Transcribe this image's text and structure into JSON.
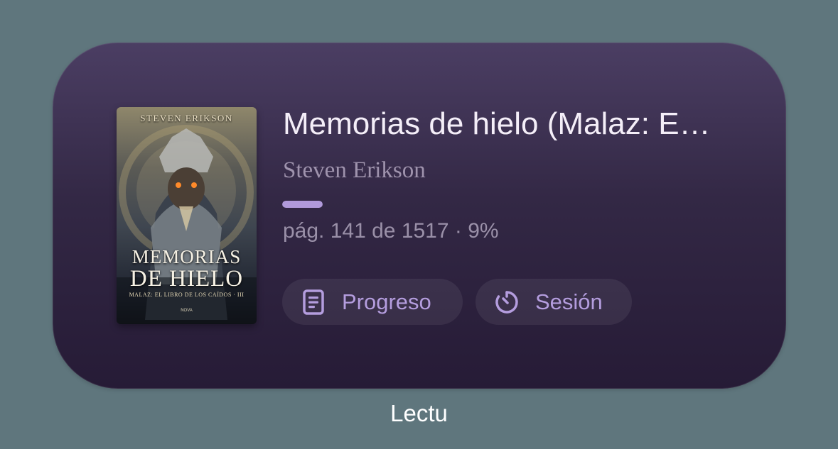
{
  "widget": {
    "book": {
      "title": "Memorias de hielo (Malaz: E…",
      "author": "Steven Erikson",
      "pages_text": "pág. 141 de 1517 · 9%",
      "progress_fraction": 0.09
    },
    "cover": {
      "author_text": "STEVEN ERIKSON",
      "title_line1": "MEMORIAS",
      "title_line2": "DE HIELO",
      "series_text": "MALAZ: EL LIBRO DE LOS CAÍDOS · III",
      "publisher_text": "NOVA"
    },
    "buttons": {
      "progress_label": "Progreso",
      "progress_icon": "document-icon",
      "session_label": "Sesión",
      "session_icon": "timer-icon"
    }
  },
  "app_label": "Lectu",
  "colors": {
    "background": "#5f767d",
    "widget_top": "#4b3e63",
    "widget_bottom": "#261b36",
    "accent": "#b19adb"
  }
}
